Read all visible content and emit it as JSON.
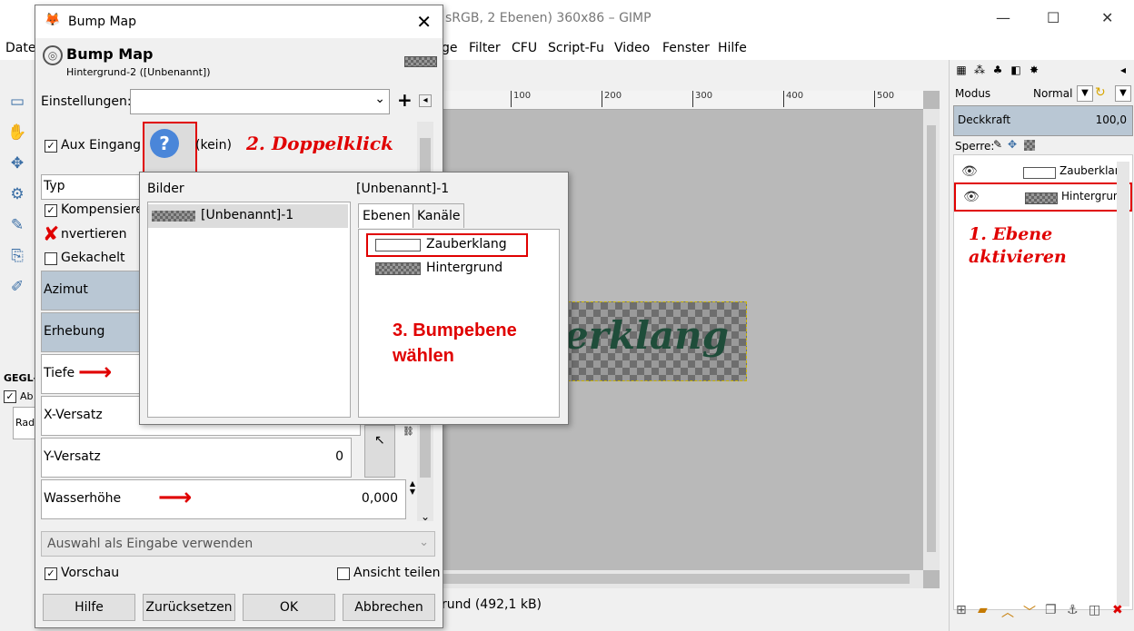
{
  "gimp": {
    "title": "sRGB, 2 Ebenen) 360x86 – GIMP",
    "menu": [
      "Date",
      "ge",
      "Filter",
      "CFU",
      "Script-Fu",
      "Video",
      "Fenster",
      "Hilfe"
    ],
    "ruler_ticks": [
      "100",
      "200",
      "300",
      "400",
      "500"
    ],
    "canvas_text": "erklang",
    "status": "rund (492,1 kB)",
    "gegl_label": "GEGL-",
    "ab_label": "Ab",
    "rad_label": "Radi"
  },
  "dock": {
    "modus_label": "Modus",
    "modus_value": "Normal",
    "opacity_label": "Deckkraft",
    "opacity_value": "100,0",
    "lock_label": "Sperre:",
    "layers": [
      {
        "name": "Zauberklang"
      },
      {
        "name": "Hintergrund"
      }
    ],
    "annotation": "1. Ebene aktivieren"
  },
  "dialog": {
    "title": "Bump Map",
    "heading": "Bump Map",
    "subheading": "Hintergrund-2 ([Unbenannt])",
    "settings_label": "Einstellungen:",
    "aux_label": "Aux Eingang",
    "aux_value": "(kein)",
    "annotation2": "2. Doppelklick",
    "typ": "Typ",
    "kompensieren": "Kompensiere",
    "invertieren": "nvertieren",
    "gekachelt": "Gekachelt",
    "azimut": "Azimut",
    "erhebung": "Erhebung",
    "tiefe": "Tiefe",
    "x_versatz": "X-Versatz",
    "y_versatz": "Y-Versatz",
    "y_versatz_value": "0",
    "wasserhoehe": "Wasserhöhe",
    "wasserhoehe_value": "0,000",
    "selection_input": "Auswahl als Eingabe verwenden",
    "vorschau": "Vorschau",
    "ansicht_teilen": "Ansicht teilen",
    "buttons": {
      "hilfe": "Hilfe",
      "zuruecksetzen": "Zurücksetzen",
      "ok": "OK",
      "abbrechen": "Abbrechen"
    }
  },
  "popup": {
    "images_label": "Bilder",
    "image_name": "[Unbenannt]-1",
    "title": "[Unbenannt]-1",
    "tab_ebenen": "Ebenen",
    "tab_kanaele": "Kanäle",
    "layer1": "Zauberklang",
    "layer2": "Hintergrund",
    "annotation3": "3. Bumpebene wählen"
  },
  "colors": {
    "annotation_red": "#e00000",
    "selected_blue": "#b9c7d4",
    "canvas_text": "#1f4d3a"
  }
}
